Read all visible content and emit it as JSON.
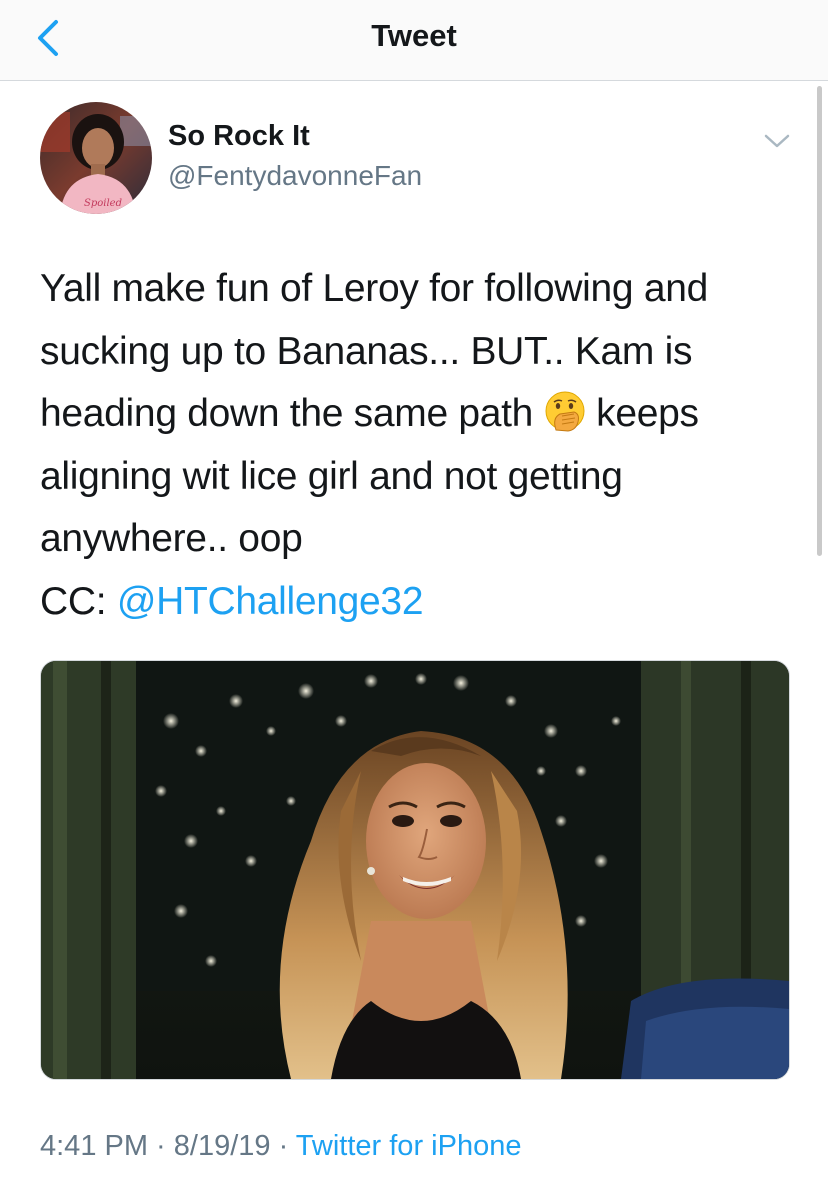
{
  "nav": {
    "title": "Tweet",
    "back_icon": "chevron-left-icon"
  },
  "tweet": {
    "author": {
      "name": "So Rock It",
      "handle": "@FentydavonneFan",
      "avatar_caption": "Spoiled"
    },
    "text_lines": [
      "Yall make fun of Leroy for following and",
      "sucking up to Bananas... BUT.. Kam is",
      "heading down the same path",
      " keeps",
      "aligning wit lice girl and not getting",
      "anywhere.. oop",
      "CC: "
    ],
    "mention": "@HTChallenge32",
    "emoji": "hand-over-mouth-emoji",
    "media": {
      "type": "gif-image",
      "description_icon": "photo-image"
    },
    "time": "4:41 PM",
    "separator": " · ",
    "date": "8/19/19",
    "source": "Twitter for iPhone"
  },
  "colors": {
    "accent": "#1da1f2",
    "secondary_text": "#657786",
    "primary_text": "#14171a",
    "divider": "#d5d9dd"
  }
}
